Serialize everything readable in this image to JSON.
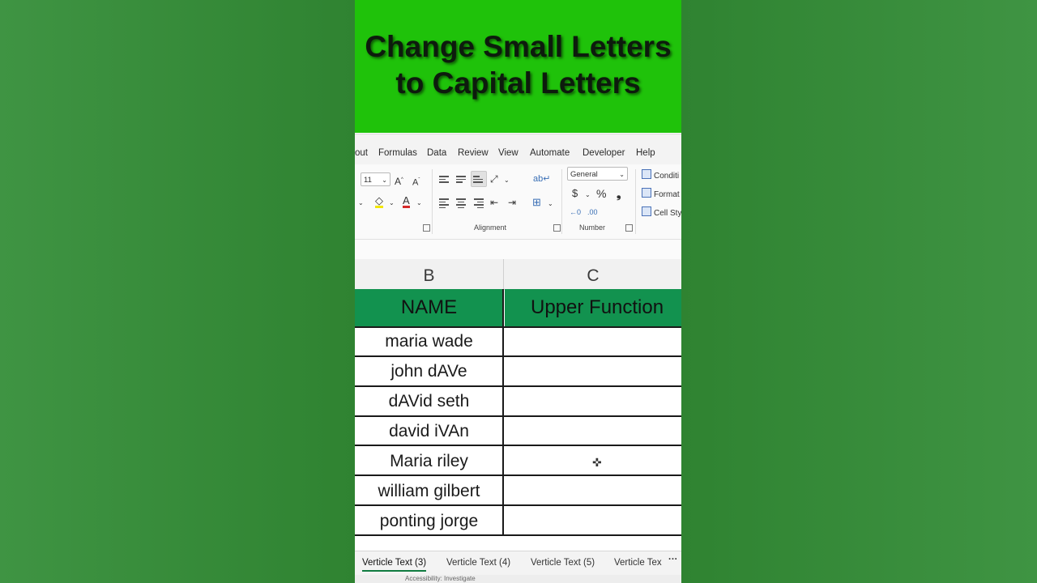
{
  "banner": {
    "title": "Change Small Letters to Capital Letters"
  },
  "ribbon": {
    "tabs": [
      "out",
      "Formulas",
      "Data",
      "Review",
      "View",
      "Automate",
      "Developer",
      "Help"
    ],
    "font_size": "11",
    "number_format": "General",
    "groups": {
      "alignment": "Alignment",
      "number": "Number"
    },
    "styles": [
      "Conditi",
      "Format",
      "Cell Sty"
    ]
  },
  "grid": {
    "columns": [
      "B",
      "C"
    ],
    "header": {
      "b": "NAME",
      "c": "Upper Function"
    },
    "rows": [
      {
        "b": "maria wade",
        "c": ""
      },
      {
        "b": "john dAVe",
        "c": ""
      },
      {
        "b": "dAVid seth",
        "c": ""
      },
      {
        "b": "david iVAn",
        "c": ""
      },
      {
        "b": "Maria riley",
        "c": ""
      },
      {
        "b": "william gilbert",
        "c": ""
      },
      {
        "b": "ponting jorge",
        "c": ""
      }
    ]
  },
  "sheets": {
    "tabs": [
      "Verticle Text (3)",
      "Verticle Text (4)",
      "Verticle Text (5)",
      "Verticle Tex"
    ],
    "active_index": 0
  },
  "status": {
    "text": "Accessibility: Investigate"
  },
  "colors": {
    "banner": "#1fc20a",
    "header_fill": "#12924f",
    "background": "#2e8a2e"
  }
}
